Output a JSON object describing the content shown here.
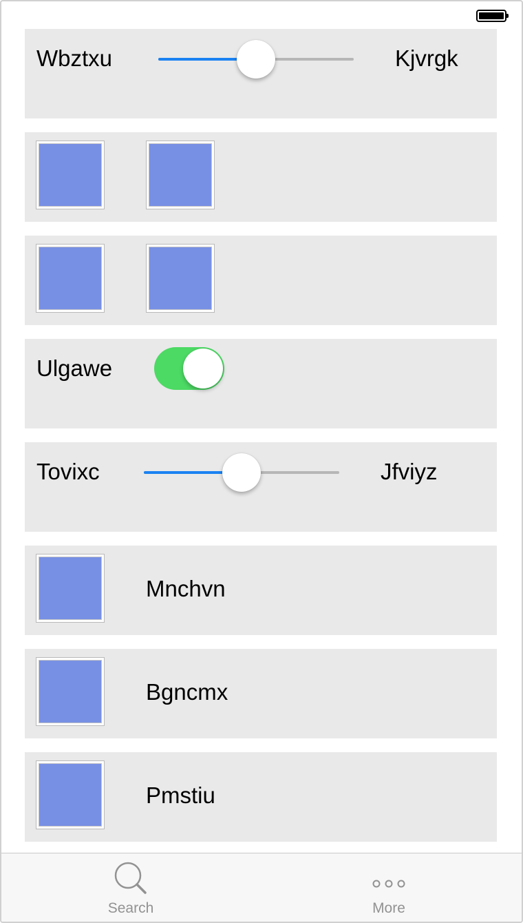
{
  "colors": {
    "row_background": "#e9e9e9",
    "swatch_fill": "#7890e4",
    "slider_fill": "#1a82f2",
    "slider_track": "#b6b6b6",
    "toggle_on": "#4cd964",
    "tab_inactive": "#929292"
  },
  "rows": [
    {
      "type": "slider",
      "min_label": "Wbztxu",
      "max_label": "Kjvrgk",
      "value_fraction": 0.5
    },
    {
      "type": "swatches",
      "count": 2
    },
    {
      "type": "swatches",
      "count": 2
    },
    {
      "type": "toggle",
      "label": "Ulgawe",
      "on": true
    },
    {
      "type": "slider",
      "min_label": "Tovixc",
      "max_label": "Jfviyz",
      "value_fraction": 0.5
    },
    {
      "type": "swatch-label",
      "label": "Mnchvn"
    },
    {
      "type": "swatch-label",
      "label": "Bgncmx"
    },
    {
      "type": "swatch-label",
      "label": "Pmstiu"
    }
  ],
  "tabbar": {
    "items": [
      {
        "label": "Search",
        "icon": "search-icon"
      },
      {
        "label": "More",
        "icon": "more-icon"
      }
    ]
  },
  "status_bar": {
    "battery_level": 1.0
  }
}
